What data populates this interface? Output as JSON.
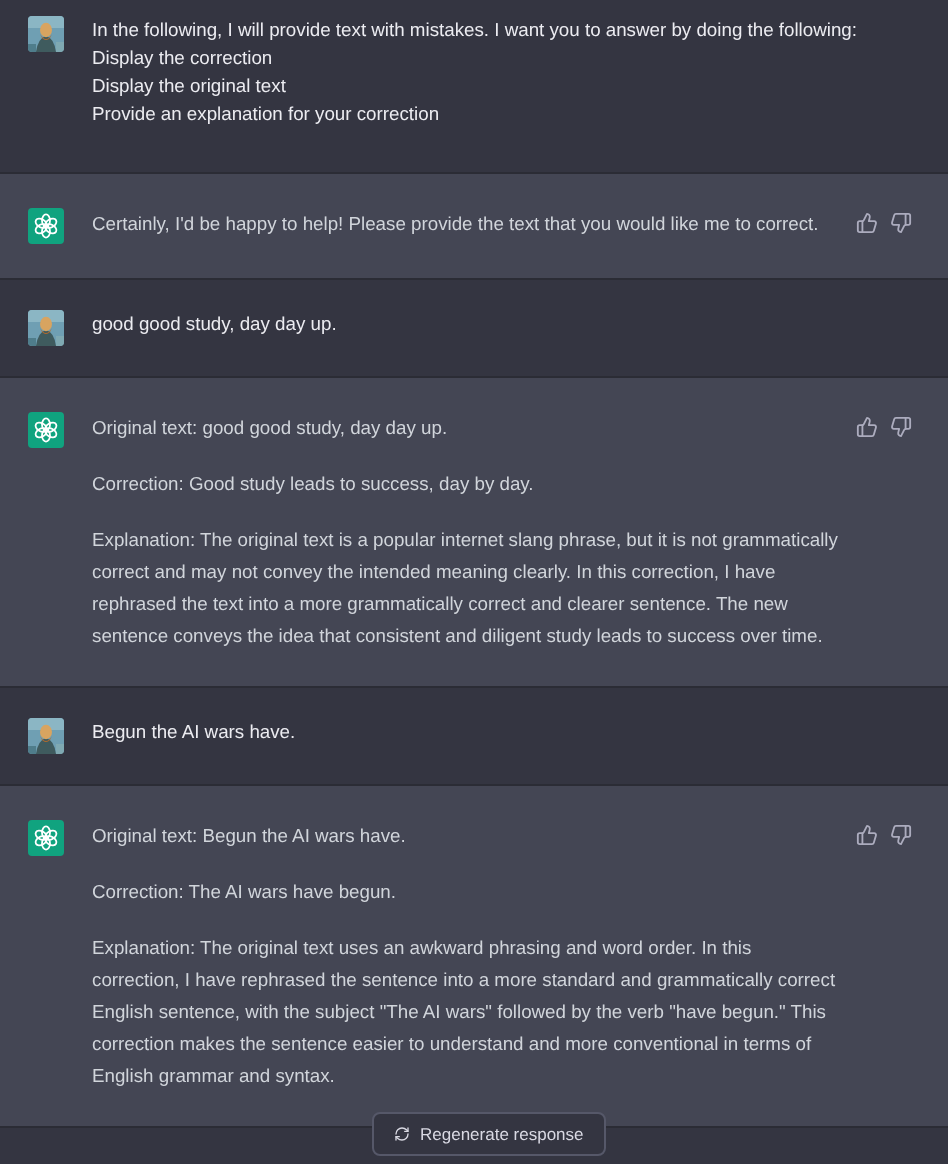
{
  "messages": [
    {
      "kind": "user",
      "paragraphs": [
        "In the following, I will provide text with mistakes.  I want you to answer by doing the following:",
        "Display the correction",
        "Display the original text",
        "Provide an explanation for your correction"
      ]
    },
    {
      "kind": "assistant",
      "paragraphs": [
        "Certainly, I'd be happy to help! Please provide the text that you would like me to correct."
      ]
    },
    {
      "kind": "user",
      "paragraphs": [
        "good good study, day day up."
      ]
    },
    {
      "kind": "assistant",
      "paragraphs": [
        "Original text: good good study, day day up.",
        "Correction: Good study leads to success, day by day.",
        "Explanation: The original text is a popular internet slang phrase, but it is not grammatically correct and may not convey the intended meaning clearly. In this correction, I have rephrased the text into a more grammatically correct and clearer sentence. The new sentence conveys the idea that consistent and diligent study leads to success over time."
      ]
    },
    {
      "kind": "user",
      "paragraphs": [
        "Begun the AI wars have."
      ]
    },
    {
      "kind": "assistant",
      "paragraphs": [
        "Original text: Begun the AI wars have.",
        "Correction: The AI wars have begun.",
        "Explanation: The original text uses an awkward phrasing and word order. In this correction, I have rephrased the sentence into a more standard and grammatically correct English sentence, with the subject \"The AI wars\" followed by the verb \"have begun.\" This correction makes the sentence easier to understand and more conventional in terms of English grammar and syntax."
      ]
    }
  ],
  "regenerate_button": {
    "label": "Regenerate response"
  }
}
